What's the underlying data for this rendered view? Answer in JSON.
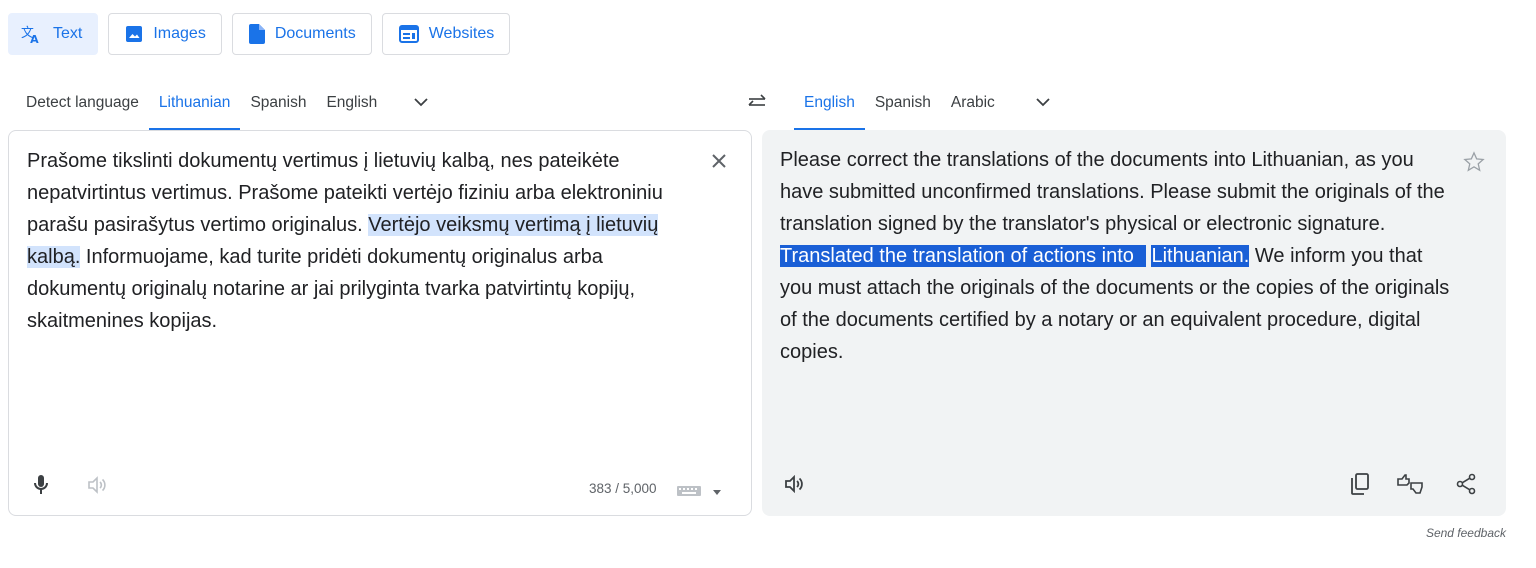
{
  "modes": [
    {
      "label": "Text",
      "icon": "translate-icon",
      "active": true
    },
    {
      "label": "Images",
      "icon": "image-icon",
      "active": false
    },
    {
      "label": "Documents",
      "icon": "document-icon",
      "active": false
    },
    {
      "label": "Websites",
      "icon": "website-icon",
      "active": false
    }
  ],
  "source_languages": [
    "Detect language",
    "Lithuanian",
    "Spanish",
    "English"
  ],
  "source_selected": "Lithuanian",
  "target_languages": [
    "English",
    "Spanish",
    "Arabic"
  ],
  "target_selected": "English",
  "source_text": {
    "before": " Prašome tikslinti dokumentų vertimus į lietuvių kalbą, nes pateikėte nepatvirtintus vertimus. Prašome pateikti vertėjo fiziniu arba elektroniniu parašu pasirašytus vertimo originalus. ",
    "highlight": "Vertėjo veiksmų vertimą į lietuvių kalbą.",
    "after": " Informuojame, kad turite pridėti dokumentų originalus arba dokumentų originalų notarine ar jai prilyginta tvarka patvirtintų kopijų, skaitmenines kopijas."
  },
  "target_text": {
    "before": "Please correct the translations of the documents into Lithuanian, as you have submitted unconfirmed translations. Please submit the originals of the translation signed by the translator's physical or electronic signature. ",
    "highlight_line1": "Translated the translation of actions into",
    "highlight_line2": "Lithuanian.",
    "after": " We inform you that you must attach the originals of the documents or the copies of the originals of the documents certified by a notary or an equivalent procedure, digital copies."
  },
  "char_count": "383 / 5,000",
  "feedback_label": "Send feedback",
  "colors": {
    "accent": "#1a73e8",
    "source_highlight": "#d2e3fc",
    "target_highlight": "#1a5fd6",
    "panel_bg": "#f1f3f4"
  }
}
